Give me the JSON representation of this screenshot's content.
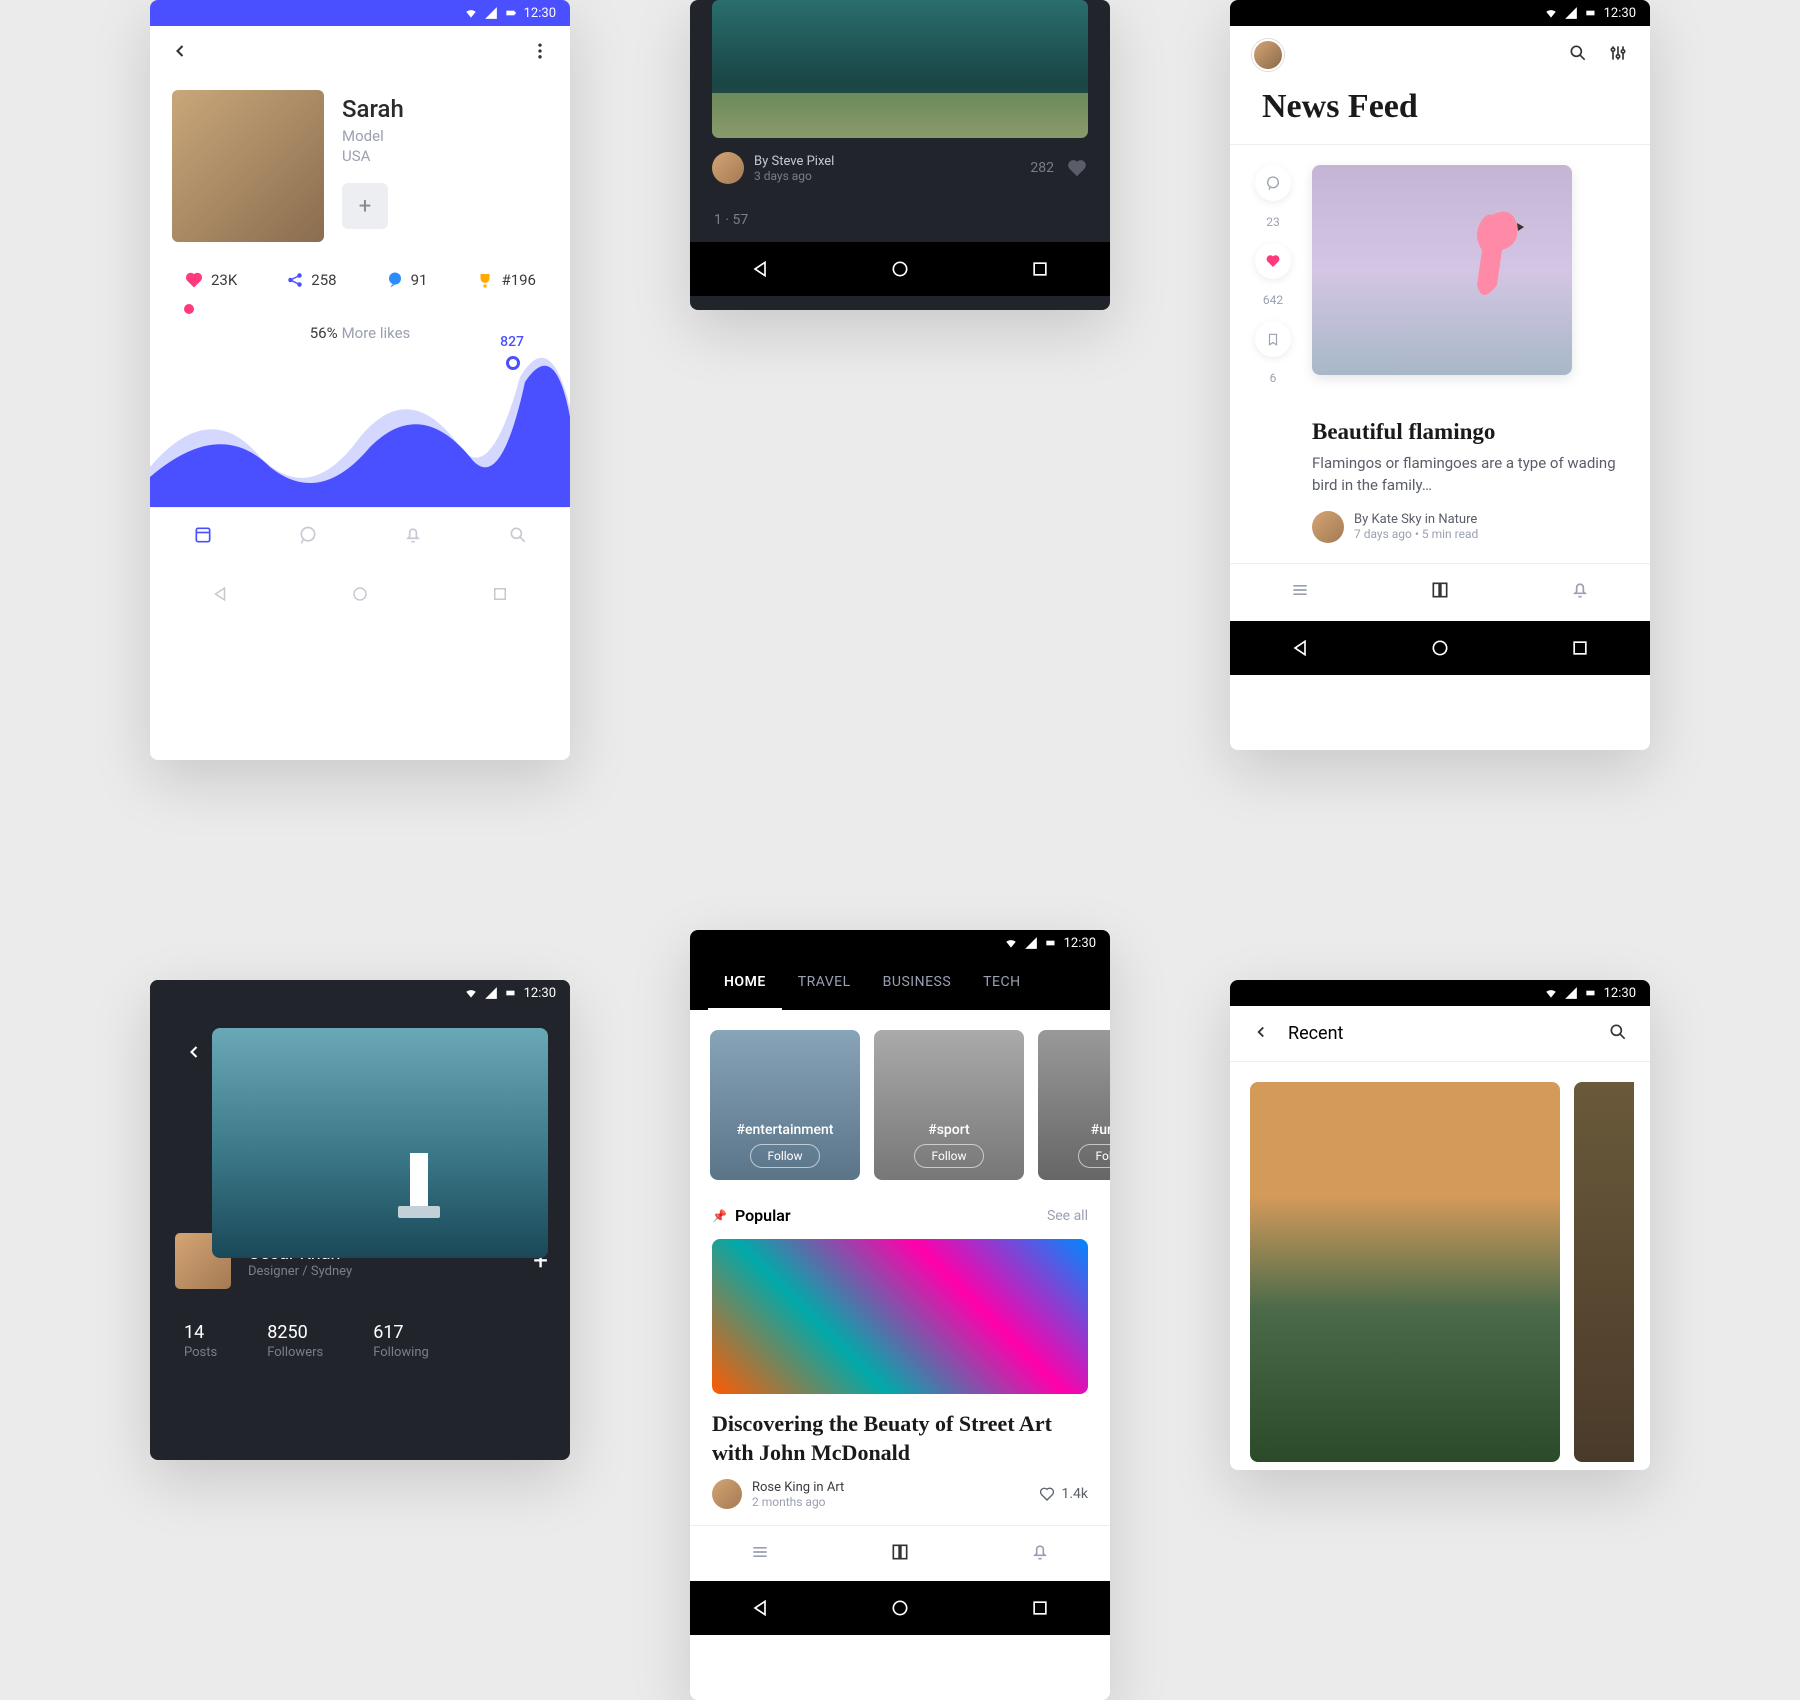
{
  "status_time": "12:30",
  "phone1": {
    "name": "Sarah",
    "role": "Model",
    "country": "USA",
    "likes": "23K",
    "shares": "258",
    "comments": "91",
    "rank": "#196",
    "percent": "56%",
    "percent_label": "More likes",
    "peak": "827"
  },
  "phone2": {
    "author": "By Steve Pixel",
    "time": "3 days ago",
    "views": "282",
    "pager": "1 · 57"
  },
  "phone3": {
    "title": "News Feed",
    "comments": "23",
    "likes": "642",
    "bookmarks": "6",
    "post_title": "Beautiful flamingo",
    "post_body": "Flamingos or flamingoes are a type of wading bird in the family…",
    "author": "By Kate Sky in Nature",
    "meta": "7 days ago   •   5 min read"
  },
  "phone4": {
    "name": "Oscar Khan",
    "role": "Designer / Sydney",
    "posts_n": "14",
    "posts_l": "Posts",
    "followers_n": "8250",
    "followers_l": "Followers",
    "following_n": "617",
    "following_l": "Following"
  },
  "phone5": {
    "tabs": {
      "home": "HOME",
      "travel": "TRAVEL",
      "business": "BUSINESS",
      "tech": "TECH"
    },
    "cat1": "#entertainment",
    "cat2": "#sport",
    "cat3": "#urban",
    "follow": "Follow",
    "section": "Popular",
    "see_all": "See all",
    "hero_title": "Discovering the Beuaty of Street Art with John McDonald",
    "hero_author": "Rose King in Art",
    "hero_time": "2 months ago",
    "hero_likes": "1.4k"
  },
  "phone6": {
    "title": "Recent"
  }
}
